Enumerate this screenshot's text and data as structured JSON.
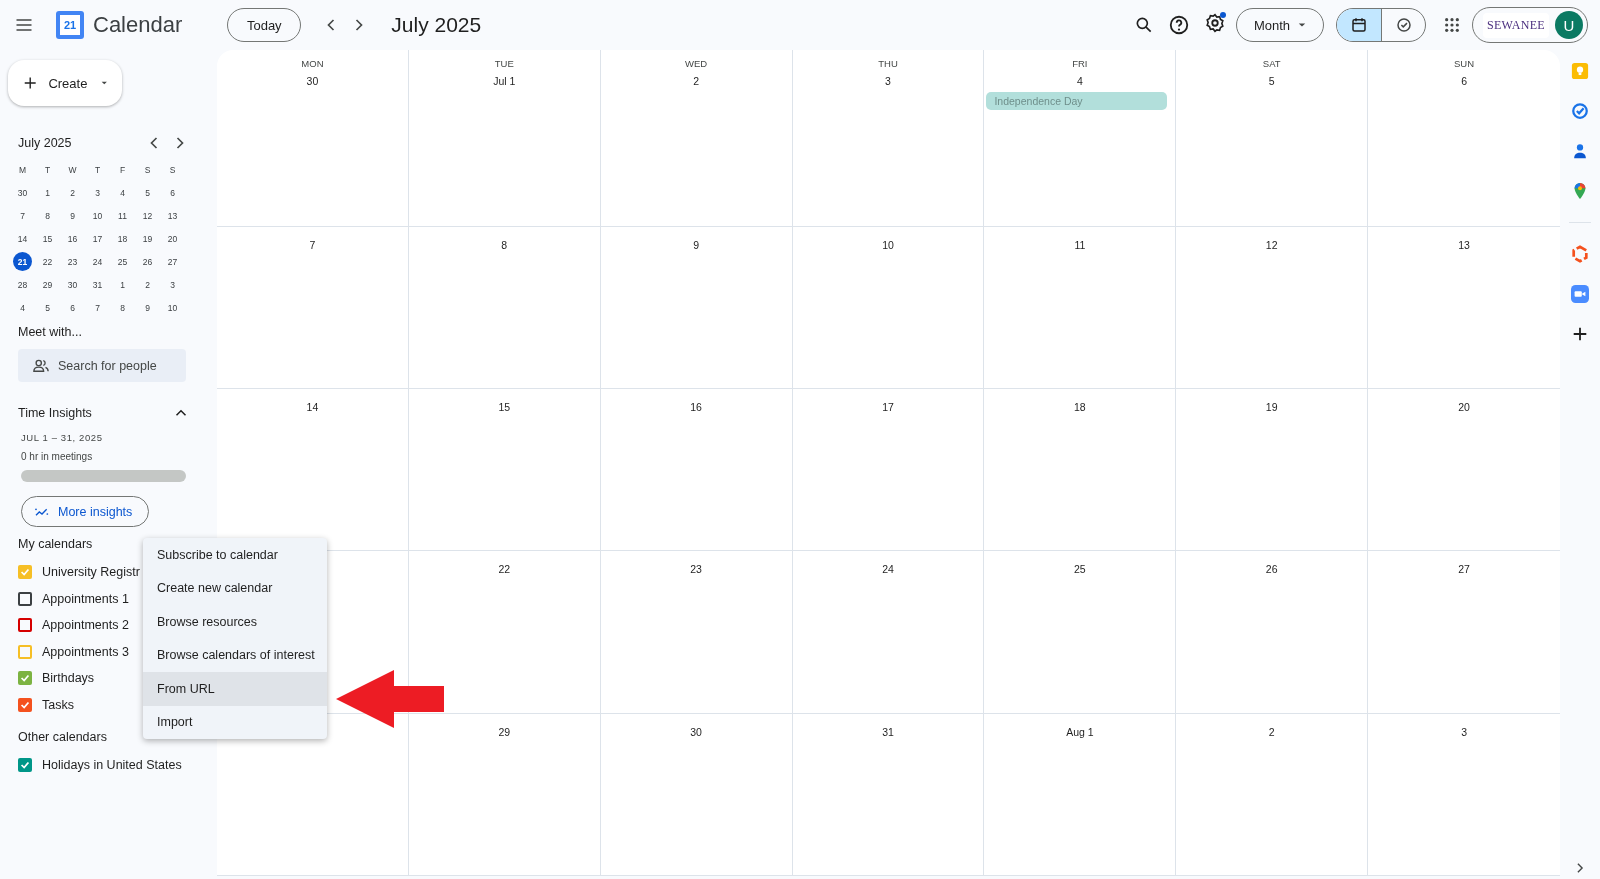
{
  "top_bar": {
    "app_name": "Calendar",
    "logo_day": "21",
    "today_button": "Today",
    "period": "July 2025",
    "settings_dot": true,
    "view_menu": "Month",
    "view_toggle": [
      {
        "kind": "calendar",
        "selected": true
      },
      {
        "kind": "tasks",
        "selected": false
      }
    ],
    "account": {
      "org_logo": "SEWANEE",
      "avatar": "U"
    }
  },
  "sidebar": {
    "create_button": "Create",
    "mini_calendar": {
      "title": "July 2025",
      "weekdays": [
        "M",
        "T",
        "W",
        "T",
        "F",
        "S",
        "S"
      ],
      "days": [
        {
          "label": "30",
          "selected": false
        },
        {
          "label": "1",
          "selected": false
        },
        {
          "label": "2",
          "selected": false
        },
        {
          "label": "3",
          "selected": false
        },
        {
          "label": "4",
          "selected": false
        },
        {
          "label": "5",
          "selected": false
        },
        {
          "label": "6",
          "selected": false
        },
        {
          "label": "7",
          "selected": false
        },
        {
          "label": "8",
          "selected": false
        },
        {
          "label": "9",
          "selected": false
        },
        {
          "label": "10",
          "selected": false
        },
        {
          "label": "11",
          "selected": false
        },
        {
          "label": "12",
          "selected": false
        },
        {
          "label": "13",
          "selected": false
        },
        {
          "label": "14",
          "selected": false
        },
        {
          "label": "15",
          "selected": false
        },
        {
          "label": "16",
          "selected": false
        },
        {
          "label": "17",
          "selected": false
        },
        {
          "label": "18",
          "selected": false
        },
        {
          "label": "19",
          "selected": false
        },
        {
          "label": "20",
          "selected": false
        },
        {
          "label": "21",
          "selected": true
        },
        {
          "label": "22",
          "selected": false
        },
        {
          "label": "23",
          "selected": false
        },
        {
          "label": "24",
          "selected": false
        },
        {
          "label": "25",
          "selected": false
        },
        {
          "label": "26",
          "selected": false
        },
        {
          "label": "27",
          "selected": false
        },
        {
          "label": "28",
          "selected": false
        },
        {
          "label": "29",
          "selected": false
        },
        {
          "label": "30",
          "selected": false
        },
        {
          "label": "31",
          "selected": false
        },
        {
          "label": "1",
          "selected": false
        },
        {
          "label": "2",
          "selected": false
        },
        {
          "label": "3",
          "selected": false
        },
        {
          "label": "4",
          "selected": false
        },
        {
          "label": "5",
          "selected": false
        },
        {
          "label": "6",
          "selected": false
        },
        {
          "label": "7",
          "selected": false
        },
        {
          "label": "8",
          "selected": false
        },
        {
          "label": "9",
          "selected": false
        },
        {
          "label": "10",
          "selected": false
        }
      ]
    },
    "meet_with": {
      "title": "Meet with...",
      "placeholder": "Search for people"
    },
    "time_insights": {
      "title": "Time Insights",
      "expanded": true,
      "range": "JUL 1 – 31, 2025",
      "summary": "0 hr in meetings",
      "level": 0,
      "button": "More insights"
    },
    "my_calendars": {
      "title": "My calendars",
      "items": [
        {
          "label": "University Registr",
          "checked": true,
          "color": "#f6bf26"
        },
        {
          "label": "Appointments 1",
          "checked": false,
          "color": "#3c4043"
        },
        {
          "label": "Appointments 2",
          "checked": false,
          "color": "#d50000"
        },
        {
          "label": "Appointments 3",
          "checked": false,
          "color": "#f6bf26"
        },
        {
          "label": "Birthdays",
          "checked": true,
          "color": "#7cb342"
        },
        {
          "label": "Tasks",
          "checked": true,
          "color": "#f4511e"
        }
      ]
    },
    "other_calendars": {
      "title": "Other calendars",
      "items": [
        {
          "label": "Holidays in United States",
          "checked": true,
          "color": "#009688"
        }
      ]
    }
  },
  "month_grid": {
    "weekdays": [
      "MON",
      "TUE",
      "WED",
      "THU",
      "FRI",
      "SAT",
      "SUN"
    ],
    "weeks": [
      [
        {
          "date": "30"
        },
        {
          "date": "Jul 1"
        },
        {
          "date": "2"
        },
        {
          "date": "3"
        },
        {
          "date": "4",
          "events": [
            {
              "title": "Independence Day",
              "color": "#b2dfdb"
            }
          ]
        },
        {
          "date": "5"
        },
        {
          "date": "6"
        }
      ],
      [
        {
          "date": "7"
        },
        {
          "date": "8"
        },
        {
          "date": "9"
        },
        {
          "date": "10"
        },
        {
          "date": "11"
        },
        {
          "date": "12"
        },
        {
          "date": "13"
        }
      ],
      [
        {
          "date": "14"
        },
        {
          "date": "15"
        },
        {
          "date": "16"
        },
        {
          "date": "17"
        },
        {
          "date": "18"
        },
        {
          "date": "19"
        },
        {
          "date": "20"
        }
      ],
      [
        {
          "date": "22"
        },
        {
          "date": "23"
        },
        {
          "date": "24"
        },
        {
          "date": "25"
        },
        {
          "date": "26"
        },
        {
          "date": "27"
        }
      ],
      [
        {
          "date": "29"
        },
        {
          "date": "30"
        },
        {
          "date": "31"
        },
        {
          "date": "Aug 1"
        },
        {
          "date": "2"
        },
        {
          "date": "3"
        }
      ]
    ]
  },
  "add_calendar_menu": [
    {
      "label": "Subscribe to calendar",
      "selected": false
    },
    {
      "label": "Create new calendar",
      "selected": false
    },
    {
      "label": "Browse resources",
      "selected": false
    },
    {
      "label": "Browse calendars of interest",
      "selected": false
    },
    {
      "label": "From URL",
      "selected": true
    },
    {
      "label": "Import",
      "selected": false
    }
  ]
}
